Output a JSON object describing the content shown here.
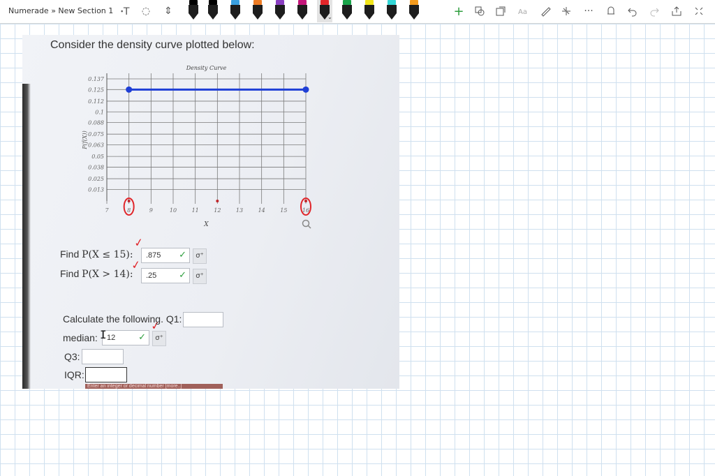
{
  "toolbar": {
    "breadcrumb": "Numerade » New Section 1",
    "icons": {
      "lasso_text": "ꞏT",
      "lasso": "◌",
      "space": "⇕",
      "add": "+",
      "more": "···"
    },
    "pen_colors": [
      "#000000",
      "#000000",
      "#3aa0e0",
      "#ef7d25",
      "#8a3fc2",
      "#c4167a",
      "#e3262a",
      "#1aa44a",
      "#f2e51a",
      "#33d6d6",
      "#f39a1c"
    ]
  },
  "question": {
    "title": "Consider the density curve plotted below:",
    "find1_prefix": "Find ",
    "find1_expr": "P(X ≤ 15):",
    "find1_value": ".875",
    "find2_prefix": "Find ",
    "find2_expr": "P(X > 14):",
    "find2_value": ".25",
    "calc_label": "Calculate the following. Q1:",
    "median_label": "median:",
    "median_value": "12",
    "q3_label": "Q3:",
    "iqr_label": "IQR:",
    "hint": "Enter an integer or decimal number [more..]",
    "check_glyph": "✓",
    "key_glyph": "σ⁺"
  },
  "chart_data": {
    "type": "line",
    "title": "Density Curve",
    "xlabel": "X",
    "ylabel": "P(f(X))",
    "x_ticks": [
      "7",
      "8",
      "9",
      "10",
      "11",
      "12",
      "13",
      "14",
      "15",
      "16"
    ],
    "y_ticks": [
      "0.013",
      "0.025",
      "0.038",
      "0.05",
      "0.063",
      "0.075",
      "0.088",
      "0.1",
      "0.112",
      "0.125",
      "0.137"
    ],
    "series": [
      {
        "x": [
          8,
          16
        ],
        "y": [
          0.125,
          0.125
        ],
        "color": "#1f3fd6"
      }
    ],
    "xlim": [
      7,
      16
    ],
    "ylim": [
      0,
      0.137
    ],
    "grid": true,
    "circled_ticks": [
      "8",
      "16"
    ]
  }
}
